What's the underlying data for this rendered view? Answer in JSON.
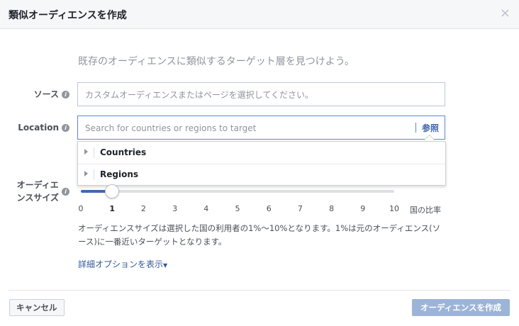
{
  "dialog": {
    "title": "類似オーディエンスを作成",
    "close_symbol": "×",
    "subtitle": "既存のオーディエンスに類似するターゲット層を見つけよう。"
  },
  "source": {
    "label": "ソース",
    "placeholder": "カスタムオーディエンスまたはページを選択してください。"
  },
  "location": {
    "label": "Location",
    "placeholder": "Search for countries or regions to target",
    "browse_label": "参照",
    "dropdown_items": [
      {
        "label": "Countries"
      },
      {
        "label": "Regions"
      }
    ]
  },
  "audience_size": {
    "label_line1": "オーディエ",
    "label_line2": "ンスサイズ",
    "value": 1,
    "min": 0,
    "max": 10,
    "ticks": [
      "0",
      "1",
      "2",
      "3",
      "4",
      "5",
      "6",
      "7",
      "8",
      "9",
      "10"
    ],
    "unit_label": "国の比率",
    "description": "オーディエンスサイズは選択した国の利用者の1%〜10%となります。1%は元のオーディエンス(ソース)に一番近いターゲットとなります。"
  },
  "advanced": {
    "link_label": "詳細オプションを表示",
    "arrow": "▼"
  },
  "footer": {
    "cancel_label": "キャンセル",
    "create_label": "オーディエンスを作成"
  },
  "icons": {
    "info": "i"
  },
  "colors": {
    "accent": "#4267b2",
    "link": "#365899",
    "disabled_primary": "#9cb4d8",
    "header_bg": "#f6f7f9"
  }
}
